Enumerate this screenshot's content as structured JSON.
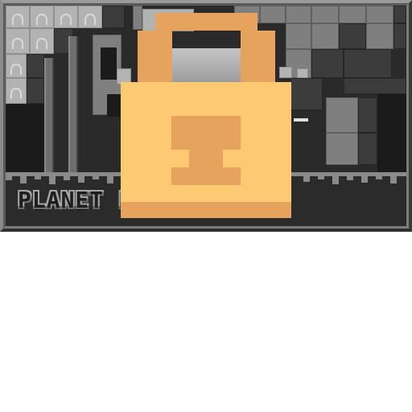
{
  "level_card": {
    "title": "PLANET F",
    "locked": true
  },
  "colors": {
    "lock_body": "#fdc973",
    "lock_shade": "#e6a35d",
    "frame": "#6e6e6e",
    "scene_background": "#2a2a2a"
  },
  "icons": {
    "lock": "padlock-icon"
  }
}
